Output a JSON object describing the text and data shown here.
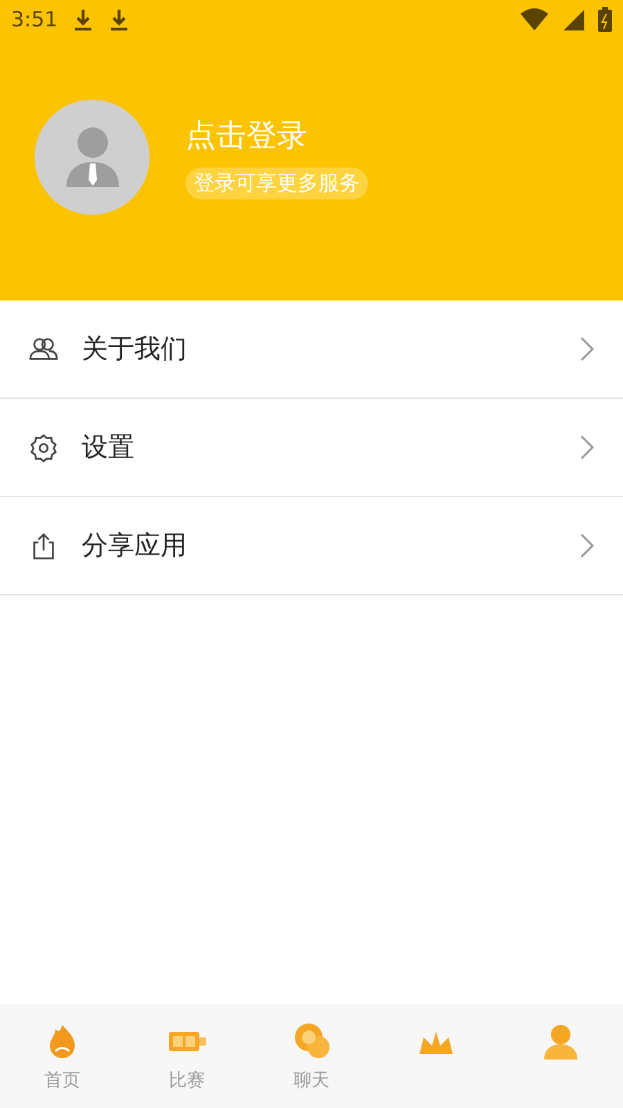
{
  "status_bar": {
    "time": "3:51"
  },
  "profile": {
    "title": "点击登录",
    "subtitle": "登录可享更多服务"
  },
  "menu": [
    {
      "kind": "people",
      "label": "关于我们"
    },
    {
      "kind": "gear",
      "label": "设置"
    },
    {
      "kind": "share",
      "label": "分享应用"
    }
  ],
  "tab_bar": [
    {
      "kind": "home",
      "label": "首页"
    },
    {
      "kind": "match",
      "label": "比赛"
    },
    {
      "kind": "chat",
      "label": "聊天"
    },
    {
      "kind": "trophy"
    },
    {
      "kind": "profile"
    }
  ]
}
